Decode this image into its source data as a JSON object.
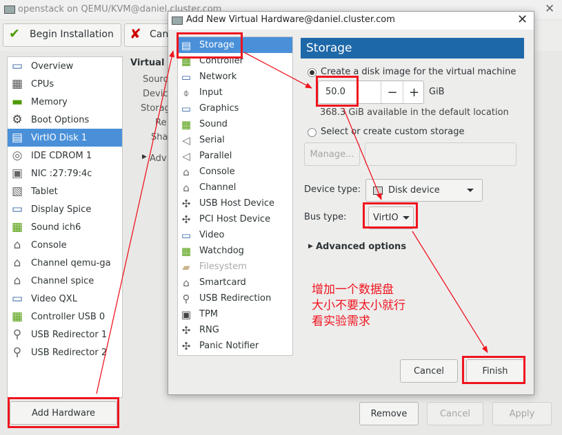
{
  "window": {
    "title": "openstack on QEMU/KVM@daniel.cluster.com"
  },
  "toolbar": {
    "begin_label": "Begin Installation",
    "cancel_label": "Cancel"
  },
  "hardware_list": [
    {
      "label": "Overview",
      "icon": "monitor-icon"
    },
    {
      "label": "CPUs",
      "icon": "cpu-icon"
    },
    {
      "label": "Memory",
      "icon": "memory-icon"
    },
    {
      "label": "Boot Options",
      "icon": "boot-options-icon"
    },
    {
      "label": "VirtIO Disk 1",
      "icon": "disk-icon",
      "selected": true
    },
    {
      "label": "IDE CDROM 1",
      "icon": "cdrom-icon"
    },
    {
      "label": "NIC :27:79:4c",
      "icon": "network-card-icon"
    },
    {
      "label": "Tablet",
      "icon": "tablet-icon"
    },
    {
      "label": "Display Spice",
      "icon": "display-icon"
    },
    {
      "label": "Sound ich6",
      "icon": "sound-icon"
    },
    {
      "label": "Console",
      "icon": "console-icon"
    },
    {
      "label": "Channel qemu-ga",
      "icon": "channel-icon"
    },
    {
      "label": "Channel spice",
      "icon": "channel-icon"
    },
    {
      "label": "Video QXL",
      "icon": "video-icon"
    },
    {
      "label": "Controller USB 0",
      "icon": "controller-icon"
    },
    {
      "label": "USB Redirector 1",
      "icon": "usb-icon"
    },
    {
      "label": "USB Redirector 2",
      "icon": "usb-icon"
    }
  ],
  "details_partial": {
    "heading": "Virtual",
    "rows": [
      "Sourc",
      "Devic",
      "Storag",
      "Re",
      "Sha"
    ],
    "advanced": "Adv"
  },
  "bottom": {
    "add_hardware": "Add Hardware",
    "remove": "Remove",
    "cancel": "Cancel",
    "apply": "Apply"
  },
  "dialog": {
    "title": "Add New Virtual Hardware@daniel.cluster.com",
    "types": [
      {
        "label": "Storage",
        "icon": "storage-icon",
        "selected": true
      },
      {
        "label": "Controller",
        "icon": "controller-icon"
      },
      {
        "label": "Network",
        "icon": "network-icon"
      },
      {
        "label": "Input",
        "icon": "mouse-icon"
      },
      {
        "label": "Graphics",
        "icon": "graphics-icon"
      },
      {
        "label": "Sound",
        "icon": "sound-icon"
      },
      {
        "label": "Serial",
        "icon": "serial-icon"
      },
      {
        "label": "Parallel",
        "icon": "parallel-icon"
      },
      {
        "label": "Console",
        "icon": "console-icon"
      },
      {
        "label": "Channel",
        "icon": "channel-icon"
      },
      {
        "label": "USB Host Device",
        "icon": "usb-host-icon"
      },
      {
        "label": "PCI Host Device",
        "icon": "pci-host-icon"
      },
      {
        "label": "Video",
        "icon": "video-icon"
      },
      {
        "label": "Watchdog",
        "icon": "watchdog-icon"
      },
      {
        "label": "Filesystem",
        "icon": "folder-icon",
        "disabled": true
      },
      {
        "label": "Smartcard",
        "icon": "smartcard-icon"
      },
      {
        "label": "USB Redirection",
        "icon": "usb-redirection-icon"
      },
      {
        "label": "TPM",
        "icon": "tpm-icon"
      },
      {
        "label": "RNG",
        "icon": "rng-icon"
      },
      {
        "label": "Panic Notifier",
        "icon": "panic-icon"
      }
    ],
    "section_title": "Storage",
    "radio_create": "Create a disk image for the virtual machine",
    "size_value": "50.0",
    "size_unit": "GiB",
    "available_text": "368.3 GiB available in the default location",
    "radio_custom": "Select or create custom storage",
    "manage_label": "Manage...",
    "device_type_label": "Device type:",
    "device_type_value": "Disk device",
    "bus_type_label": "Bus type:",
    "bus_type_value": "VirtIO",
    "advanced_label": "Advanced options",
    "cancel_label": "Cancel",
    "finish_label": "Finish"
  },
  "annotation": {
    "lines": [
      "增加一个数据盘",
      "大小不要太小就行",
      "看实验需求"
    ],
    "color": "#f0141e"
  }
}
